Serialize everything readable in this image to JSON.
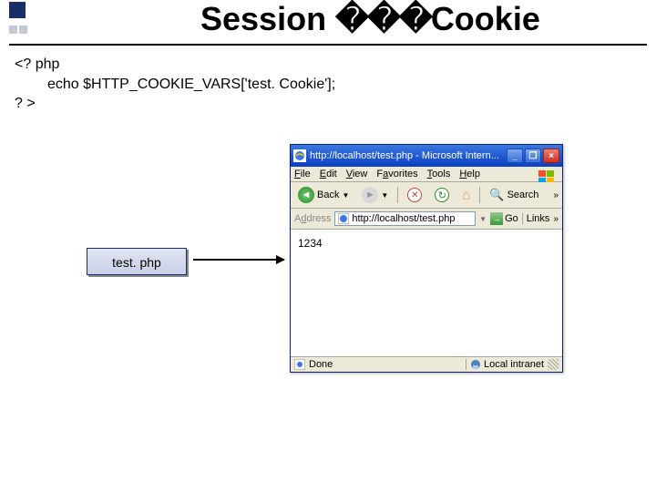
{
  "slide": {
    "title_left": "Session ",
    "title_boxes": "���",
    "title_right": "Cookie"
  },
  "code": {
    "line1": "<? php",
    "line2": "echo $HTTP_COOKIE_VARS['test. Cookie'];",
    "line3": "? >"
  },
  "label": {
    "text": "test. php"
  },
  "browser": {
    "titlebar": "http://localhost/test.php - Microsoft Intern...",
    "menu": {
      "file": "File",
      "edit": "Edit",
      "view": "View",
      "favorites": "Favorites",
      "tools": "Tools",
      "help": "Help"
    },
    "toolbar": {
      "back": "Back",
      "search": "Search"
    },
    "address": {
      "label": "Address",
      "url": "http://localhost/test.php",
      "go": "Go",
      "links": "Links"
    },
    "content": "1234",
    "status": {
      "done": "Done",
      "zone": "Local intranet"
    }
  }
}
